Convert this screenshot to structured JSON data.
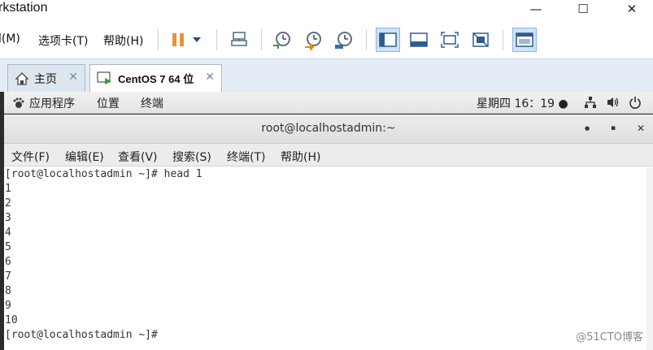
{
  "host": {
    "title": "rkstation",
    "window_controls": [
      "—",
      "☐",
      "✕"
    ],
    "menu": [
      "l(M)",
      "选项卡(T)",
      "帮助(H)"
    ],
    "toolbar_icons": [
      "pause-icon",
      "dropdown-icon",
      "send-keys-icon",
      "snapshot-icon",
      "revert-snapshot-icon",
      "manage-snapshots-icon",
      "fit-guest-icon",
      "console-view-icon",
      "full-screen-icon",
      "no-stretch-icon",
      "library-icon"
    ]
  },
  "tabs": [
    {
      "label": "主页",
      "close": "✕"
    },
    {
      "label": "CentOS 7 64 位",
      "close": "✕"
    }
  ],
  "gnome": {
    "apps": "应用程序",
    "places": "位置",
    "terminal": "终端",
    "clock": "星期四 16：19 ●"
  },
  "terminal": {
    "title": "root@localhostadmin:~",
    "controls": [
      "●",
      "▪",
      "✕"
    ],
    "menu": [
      "文件(F)",
      "编辑(E)",
      "查看(V)",
      "搜索(S)",
      "终端(T)",
      "帮助(H)"
    ],
    "lines": [
      "[root@localhostadmin ~]# head 1",
      "1",
      "2",
      "3",
      "4",
      "5",
      "6",
      "7",
      "8",
      "9",
      "10",
      "[root@localhostadmin ~]# "
    ]
  },
  "watermark": "@51CTO博客"
}
